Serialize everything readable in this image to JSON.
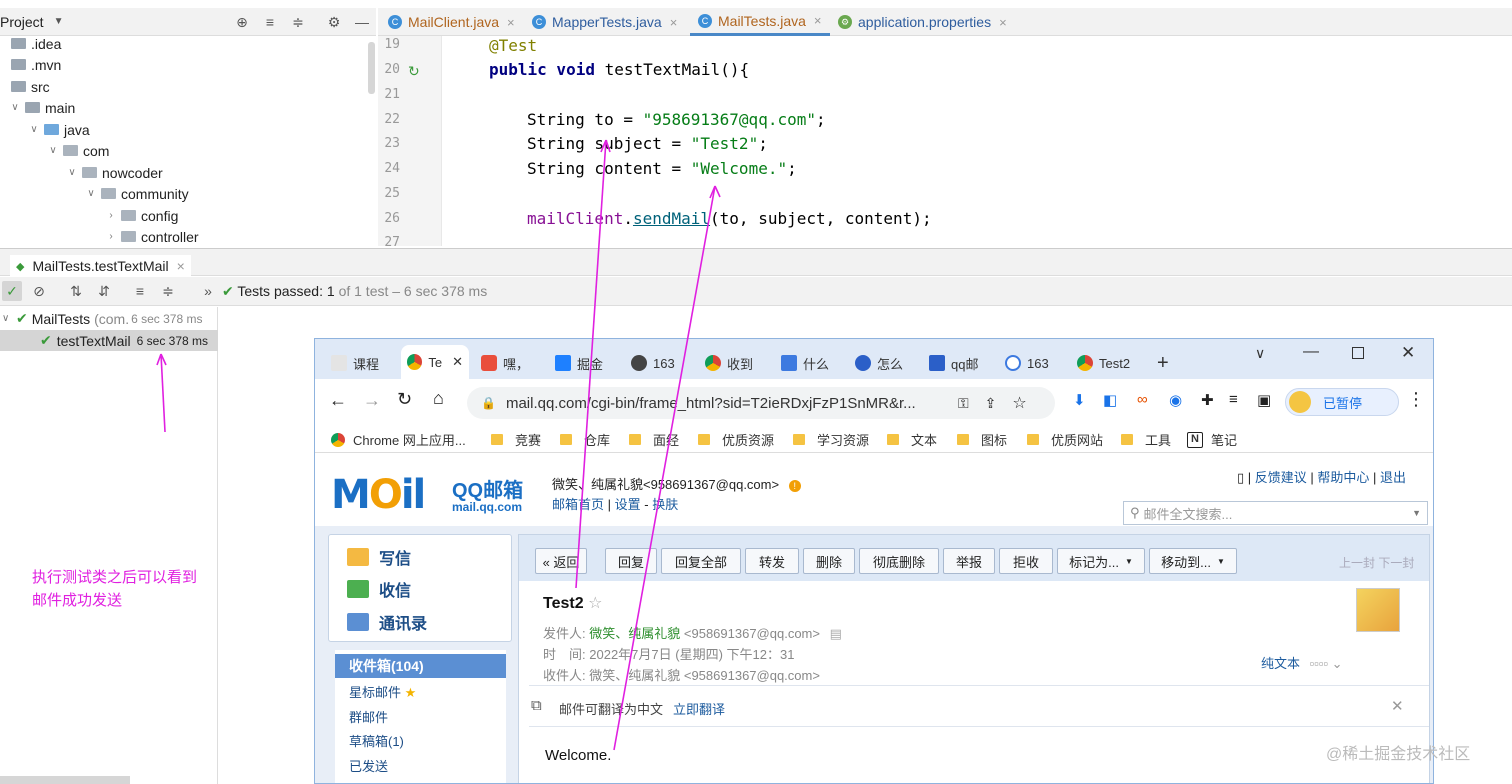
{
  "ide": {
    "project_title": "Project",
    "tree": [
      ".idea",
      ".mvn",
      "src",
      "main",
      "java",
      "com",
      "nowcoder",
      "community",
      "config",
      "controller"
    ],
    "tabs": [
      "MailClient.java",
      "MapperTests.java",
      "MailTests.java",
      "application.properties"
    ],
    "active_tab": "MailTests.java",
    "line_numbers": [
      "19",
      "20",
      "21",
      "22",
      "23",
      "24",
      "25",
      "26",
      "27"
    ],
    "code": {
      "l19": "@Test",
      "l20_kw": "public void ",
      "l20_rest": "testTextMail(){",
      "l22_type": "String to = ",
      "l22_val": "\"958691367@qq.com\"",
      "l22_end": ";",
      "l23_type": "String subject = ",
      "l23_val": "\"Test2\"",
      "l23_end": ";",
      "l24_type": "String content = ",
      "l24_val": "\"Welcome.\"",
      "l24_end": ";",
      "l26_field": "mailClient",
      "l26_dot": ".",
      "l26_method": "sendMail",
      "l26_args": "(to, subject, content);"
    },
    "run": {
      "tab_label": "MailTests.testTextMail",
      "status_prefix": "Tests passed:",
      "status_count": "1",
      "status_suffix": "of 1 test – 6 sec 378 ms",
      "tree_root": "MailTests",
      "tree_root_pkg": "(com.",
      "tree_root_time": "6 sec 378 ms",
      "tree_child": "testTextMail",
      "tree_child_time": "6 sec 378 ms"
    }
  },
  "annotation": {
    "line1": "执行测试类之后可以看到",
    "line2": "邮件成功发送",
    "color": "#e020e0"
  },
  "chrome": {
    "tabs": [
      "课程",
      "Te",
      "嘿，",
      "掘金",
      "163",
      "收到",
      "什么",
      "怎么",
      "qq邮",
      "163",
      "Test2"
    ],
    "url": "mail.qq.com/cgi-bin/frame_html?sid=T2ieRDxjFzP1SnMR&r...",
    "profile_label": "已暂停",
    "bookmarks": [
      "Chrome 网上应用...",
      "竞赛",
      "仓库",
      "面经",
      "优质资源",
      "学习资源",
      "文本",
      "图标",
      "优质网站",
      "工具",
      "笔记"
    ]
  },
  "mail": {
    "logo_text": "MOil",
    "logo_cn": "QQ邮箱",
    "logo_domain": "mail.qq.com",
    "user_line": "微笑、纯属礼貌<958691367@qq.com>",
    "links": [
      "邮箱首页",
      "设置",
      "换肤"
    ],
    "top_links": [
      "反馈建议",
      "帮助中心",
      "退出"
    ],
    "search_placeholder": "邮件全文搜索...",
    "nav": [
      "写信",
      "收信",
      "通讯录"
    ],
    "folders": [
      "收件箱(104)",
      "星标邮件",
      "群邮件",
      "草稿箱(1)",
      "已发送"
    ],
    "toolbar": [
      "« 返回",
      "回复",
      "回复全部",
      "转发",
      "删除",
      "彻底删除",
      "举报",
      "拒收",
      "标记为...",
      "移动到..."
    ],
    "pager": "上一封 下一封",
    "subject": "Test2",
    "from_label": "发件人:",
    "from_name": "微笑、纯属礼貌",
    "from_addr": "<958691367@qq.com>",
    "time_label": "时　间:",
    "time_value": "2022年7月7日 (星期四) 下午12：31",
    "to_label": "收件人:",
    "to_value": "微笑、纯属礼貌 <958691367@qq.com>",
    "plain_text": "纯文本",
    "translate_msg": "邮件可翻译为中文",
    "translate_link": "立即翻译",
    "body": "Welcome."
  },
  "watermark": "@稀土掘金技术社区"
}
